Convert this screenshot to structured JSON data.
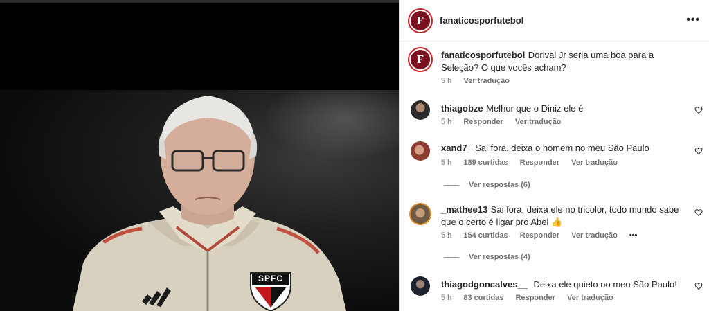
{
  "header": {
    "username": "fanaticosporfutebol",
    "menu": "•••"
  },
  "caption": {
    "username": "fanaticosporfutebol",
    "text": "Dorival Jr seria uma boa para a Seleção? O que vocês acham?",
    "time": "5 h",
    "translate": "Ver tradução"
  },
  "comments": [
    {
      "username": "thiagobze",
      "text": "Melhor que o Diniz ele é",
      "time": "5 h",
      "likes": "",
      "reply": "Responder",
      "translate": "Ver tradução"
    },
    {
      "username": "xand7_",
      "text": "Sai fora, deixa o homem no meu São Paulo",
      "time": "5 h",
      "likes": "189 curtidas",
      "reply": "Responder",
      "translate": "Ver tradução",
      "replies": "Ver respostas (6)"
    },
    {
      "username": "_mathee13",
      "text": "Sai fora, deixa ele no tricolor, todo mundo sabe que o certo é ligar pro Abel 👍",
      "time": "5 h",
      "likes": "154 curtidas",
      "reply": "Responder",
      "translate": "Ver tradução",
      "more": "•••",
      "replies": "Ver respostas (4)"
    },
    {
      "username": "thiagodgoncalves__",
      "text": "Deixa ele quieto no meu São Paulo!",
      "time": "5 h",
      "likes": "83 curtidas",
      "reply": "Responder",
      "translate": "Ver tradução"
    }
  ],
  "photo": {
    "badge": "SPFC"
  },
  "colors": {
    "accent": "#c22222",
    "logo_bg": "#7a1020",
    "meta": "#737373"
  }
}
